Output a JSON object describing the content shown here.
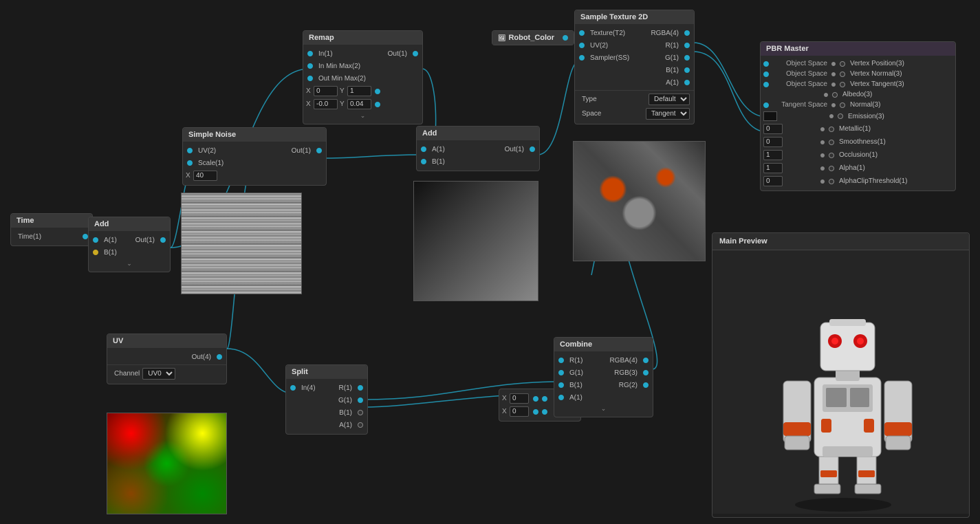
{
  "nodes": {
    "time": {
      "title": "Time",
      "output": "Time(1)"
    },
    "add_left": {
      "title": "Add",
      "inputs": [
        "A(1)",
        "B(1)"
      ],
      "output": "Out(1)",
      "chevron": "v"
    },
    "uv": {
      "title": "UV",
      "output": "Out(4)",
      "channel_label": "Channel",
      "channel_value": "UV0"
    },
    "simple_noise": {
      "title": "Simple Noise",
      "inputs": [
        "UV(2)",
        "Scale(1)"
      ],
      "output": "Out(1)",
      "scale_value": "40"
    },
    "split": {
      "title": "Split",
      "input": "In(4)",
      "outputs": [
        "R(1)",
        "G(1)",
        "B(1)",
        "A(1)"
      ]
    },
    "remap": {
      "title": "Remap",
      "inputs": [
        "In(1)",
        "In Min Max(2)",
        "Out Min Max(2)"
      ],
      "output": "Out(1)",
      "x_val1": "0",
      "y_val1": "1",
      "x_val2": "-0.0",
      "y_val2": "0.04",
      "chevron": "v"
    },
    "add_right": {
      "title": "Add",
      "inputs": [
        "A(1)",
        "B(1)"
      ],
      "output": "Out(1)"
    },
    "combine": {
      "title": "Combine",
      "inputs": [
        "R(1)",
        "G(1)",
        "B(1)",
        "A(1)"
      ],
      "outputs": [
        "RGBA(4)",
        "RGB(3)",
        "RG(2)"
      ],
      "chevron": "v"
    },
    "xy_combine": {
      "x_val1": "0",
      "x_val2": "0"
    },
    "robot_color": {
      "title": "Robot_Color"
    },
    "sample_texture": {
      "title": "Sample Texture 2D",
      "inputs": [
        "Texture(T2)",
        "UV(2)",
        "Sampler(SS)"
      ],
      "outputs": [
        "RGBA(4)",
        "R(1)",
        "G(1)",
        "B(1)",
        "A(1)"
      ],
      "type_label": "Type",
      "type_value": "Default",
      "space_label": "Space",
      "space_value": "Tangent"
    },
    "pbr_master": {
      "title": "PBR Master",
      "inputs": [
        {
          "label_left": "Object Space",
          "label_right": "Vertex Position(3)"
        },
        {
          "label_left": "Object Space",
          "label_right": "Vertex Normal(3)"
        },
        {
          "label_left": "Object Space",
          "label_right": "Vertex Tangent(3)"
        },
        {
          "label_left": "",
          "label_right": "Albedo(3)"
        },
        {
          "label_left": "Tangent Space",
          "label_right": "Normal(3)"
        },
        {
          "label_left": "",
          "label_right": "Emission(3)"
        },
        {
          "label_left": "X 0",
          "label_right": "Metallic(1)"
        },
        {
          "label_left": "X 0",
          "label_right": "Smoothness(1)"
        },
        {
          "label_left": "X 1",
          "label_right": "Occlusion(1)"
        },
        {
          "label_left": "X 1",
          "label_right": "Alpha(1)"
        },
        {
          "label_left": "X 0",
          "label_right": "AlphaClipThreshold(1)"
        }
      ]
    },
    "main_preview": {
      "title": "Main Preview"
    }
  },
  "colors": {
    "accent_cyan": "#22aacc",
    "port_orange": "#dd8844",
    "node_bg": "#2a2a2a",
    "node_header": "#383838",
    "background": "#1a1a1a"
  }
}
